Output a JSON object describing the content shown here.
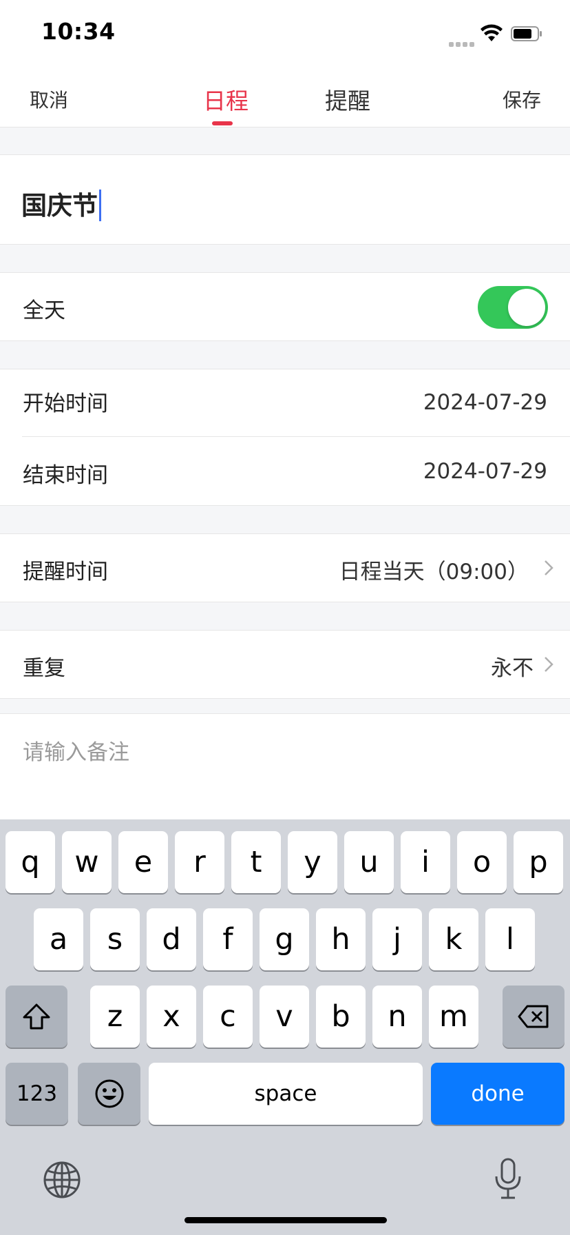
{
  "status_bar": {
    "time": "10:34"
  },
  "nav": {
    "cancel": "取消",
    "save": "保存",
    "tabs": [
      "日程",
      "提醒"
    ],
    "active_tab": 0,
    "accent_color": "#e8344a"
  },
  "form": {
    "title_value": "国庆节",
    "all_day": {
      "label": "全天",
      "on": true,
      "color": "#34c759"
    },
    "start": {
      "label": "开始时间",
      "value": "2024-07-29"
    },
    "end": {
      "label": "结束时间",
      "value": "2024-07-29"
    },
    "reminder": {
      "label": "提醒时间",
      "value": "日程当天（09:00）"
    },
    "repeat": {
      "label": "重复",
      "value": "永不"
    },
    "notes_placeholder": "请输入备注"
  },
  "keyboard": {
    "row1": [
      "q",
      "w",
      "e",
      "r",
      "t",
      "y",
      "u",
      "i",
      "o",
      "p"
    ],
    "row2": [
      "a",
      "s",
      "d",
      "f",
      "g",
      "h",
      "j",
      "k",
      "l"
    ],
    "row3": [
      "z",
      "x",
      "c",
      "v",
      "b",
      "n",
      "m"
    ],
    "numbers": "123",
    "space": "space",
    "done": "done",
    "done_color": "#0a7aff"
  }
}
